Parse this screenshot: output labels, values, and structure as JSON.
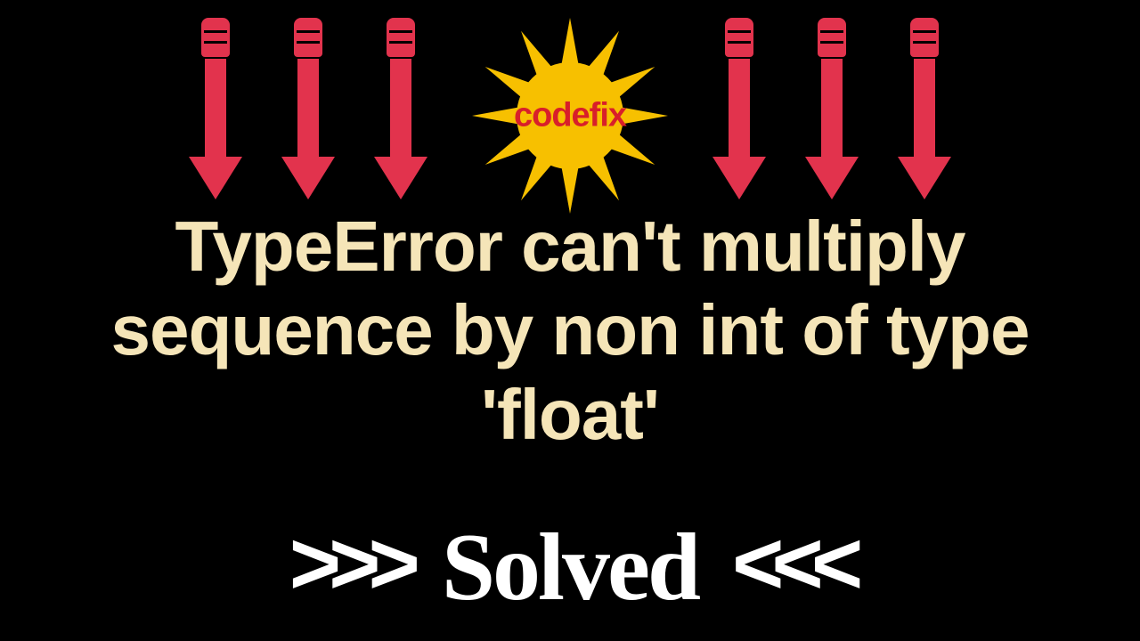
{
  "badge": {
    "label": "codefix"
  },
  "error": {
    "message": "TypeError can't multiply sequence by non int of type 'float'"
  },
  "solved": {
    "left_arrows": ">>>",
    "text": "Solved",
    "right_arrows": "<<<"
  }
}
